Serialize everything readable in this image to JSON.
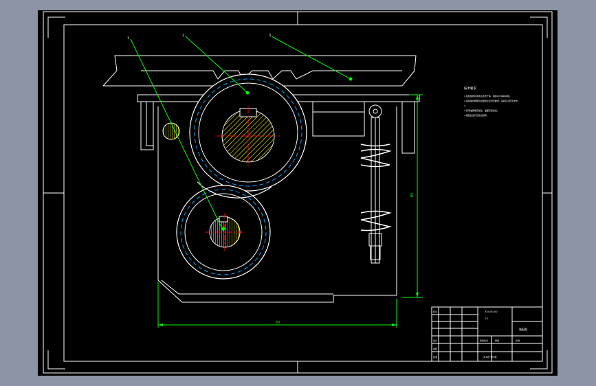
{
  "drawing": {
    "background": "#000000",
    "line_color": "#ffffff",
    "leader_color": "#00ff00",
    "dashed_color": "#00aaff",
    "centerline_color": "#ff0000",
    "hatch_color": "#ffff00",
    "part_callouts": [
      "1",
      "2",
      "3"
    ],
    "dimension_height": "85",
    "dimension_width": "80",
    "tech_notes_title": "技术要求",
    "tech_notes": [
      "1.装配前所有零件应清洗干净，箱体内不得有杂物。",
      "2.齿轮啮合侧隙及接触斑点应符合要求，运转应平稳无冲击。",
      "3.",
      "4.润滑油按规定加注，油面高度合适。",
      "5.装配后进行空载试运转。"
    ],
    "title_block": {
      "drawing_number": "XXX-00-00",
      "scale": "1:1",
      "sheet": "共1张 第1张",
      "labels": [
        "标记",
        "处数",
        "分区",
        "更改文件号",
        "签名",
        "年月日",
        "设计",
        "标准化",
        "审核",
        "工艺",
        "批准",
        "阶段标记",
        "重量",
        "比例"
      ],
      "company": "装配图"
    }
  }
}
